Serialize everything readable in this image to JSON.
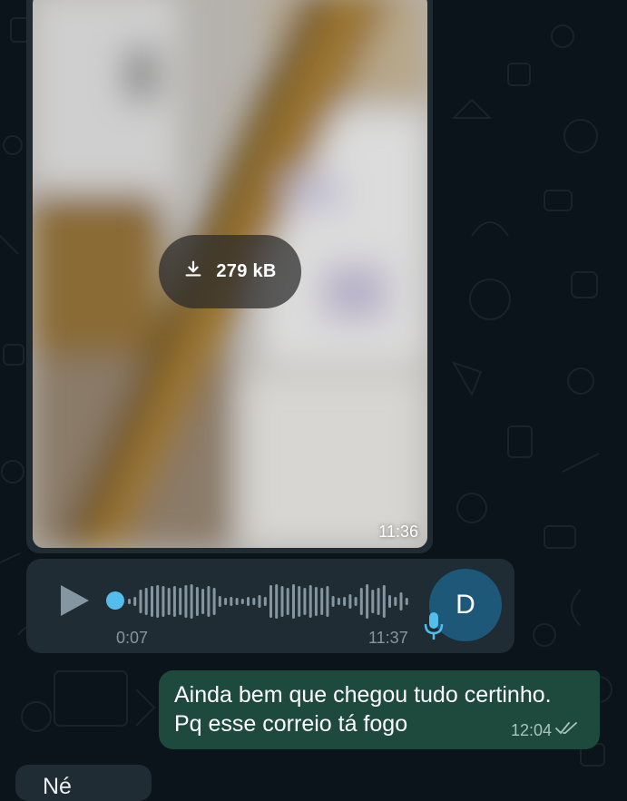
{
  "media_message": {
    "download_size": "279 kB",
    "time": "11:36",
    "download_icon": "download-icon"
  },
  "audio_message": {
    "duration": "0:07",
    "time": "11:37",
    "sender_initial": "D",
    "play_icon": "play-icon",
    "mic_icon": "microphone-icon",
    "progress": 0
  },
  "outgoing_message": {
    "text_line1": "Ainda bem que chegou tudo certinho.",
    "text_line2": "Pq esse correio tá fogo",
    "time": "12:04",
    "status_icon": "double-check-icon"
  },
  "incoming_partial": {
    "text": "Né"
  },
  "colors": {
    "background": "#0b141a",
    "bubble_incoming": "#202c33",
    "bubble_outgoing": "#1d4a3d",
    "accent": "#53bdeb",
    "avatar": "#1d5879"
  }
}
